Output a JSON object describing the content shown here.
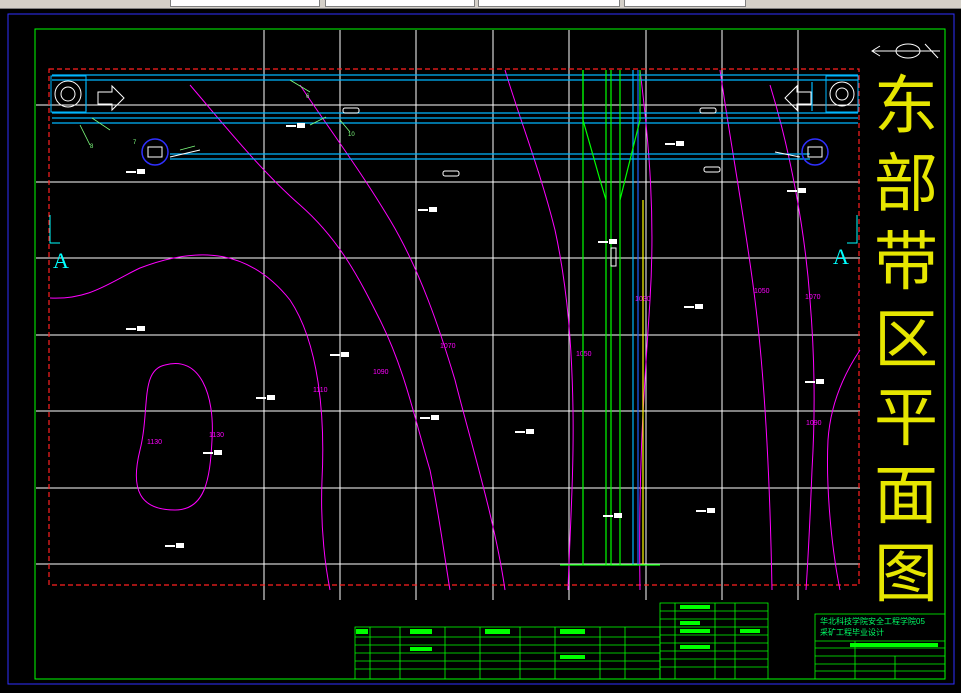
{
  "drawing_title_chars": [
    "东",
    "部",
    "带",
    "区",
    "平",
    "面",
    "图"
  ],
  "section_marks": {
    "left": "A",
    "right": "A"
  },
  "contour_labels": [
    "1130",
    "1130",
    "1110",
    "1090",
    "1070",
    "1050",
    "1030",
    "1050",
    "1070",
    "1090"
  ],
  "title_block": {
    "school": "华北科技学院安全工程学院05",
    "subtitle": "采矿工程毕业设计"
  },
  "colors": {
    "frame": "#00ff00",
    "grid": "#ffffff",
    "contour": "#ff00ff",
    "roadway": "#00b7ff",
    "boundary": "#ff2020",
    "title": "#e6e600"
  }
}
